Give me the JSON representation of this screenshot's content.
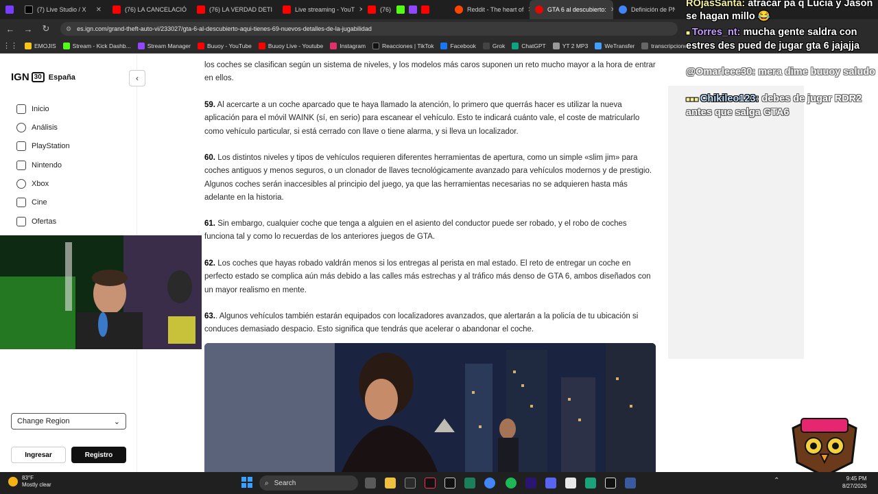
{
  "browser": {
    "tabs": [
      {
        "label": "",
        "color": "#7a3cff",
        "active": false
      },
      {
        "label": "(7) Live Studio / X",
        "color": "#000000",
        "active": false
      },
      {
        "label": "(76) LA CANCELACIÓ",
        "color": "#ff0000",
        "active": false
      },
      {
        "label": "(76) LA VERDAD DETI",
        "color": "#ff0000",
        "active": false
      },
      {
        "label": "Live streaming - YouT",
        "color": "#ff0000",
        "active": false
      },
      {
        "label": "(76)",
        "color": "#ff0000",
        "active": false
      },
      {
        "label": "Reddit - The heart of",
        "color": "#ff4500",
        "active": false
      },
      {
        "label": "GTA 6 al descubierto:",
        "color": "#e10a00",
        "active": true
      },
      {
        "label": "Definición de PN| en",
        "color": "#4285f4",
        "active": false
      }
    ],
    "url": "es.ign.com/grand-theft-auto-vi/233027/gta-6-al-descubierto-aqui-tienes-69-nuevos-detalles-de-la-jugabilidad",
    "bookmarks": [
      {
        "label": "EMOJIS",
        "color": "#f5c518"
      },
      {
        "label": "Stream - Kick Dashb...",
        "color": "#53fc18"
      },
      {
        "label": "Stream Manager",
        "color": "#9146ff"
      },
      {
        "label": "Buuoy - YouTube",
        "color": "#ff0000"
      },
      {
        "label": "Buuoy Live - Youtube",
        "color": "#ff0000"
      },
      {
        "label": "Instagram",
        "color": "#e1306c"
      },
      {
        "label": "Reacciones | TikTok",
        "color": "#111111"
      },
      {
        "label": "Facebook",
        "color": "#1877f2"
      },
      {
        "label": "Grok",
        "color": "#444444"
      },
      {
        "label": "ChatGPT",
        "color": "#10a37f"
      },
      {
        "label": "YT 2 MP3",
        "color": "#999999"
      },
      {
        "label": "WeTransfer",
        "color": "#409fff"
      },
      {
        "label": "transcripciones",
        "color": "#666666"
      }
    ]
  },
  "site": {
    "logo_brand": "IGN",
    "logo_badge": "30",
    "logo_region": "España",
    "nav": [
      {
        "label": "Inicio",
        "icon": "home-icon"
      },
      {
        "label": "Análisis",
        "icon": "review-icon"
      },
      {
        "label": "PlayStation",
        "icon": "playstation-icon"
      },
      {
        "label": "Nintendo",
        "icon": "nintendo-icon"
      },
      {
        "label": "Xbox",
        "icon": "xbox-icon"
      },
      {
        "label": "Cine",
        "icon": "film-icon"
      },
      {
        "label": "Ofertas",
        "icon": "tag-icon"
      }
    ],
    "region_select": "Change Region",
    "login_label": "Ingresar",
    "register_label": "Registro"
  },
  "article": {
    "paragraphs": [
      {
        "num": "",
        "text": "los coches se clasifican según un sistema de niveles, y los modelos más caros suponen un reto mucho mayor a la hora de entrar en ellos."
      },
      {
        "num": "59.",
        "text": " Al acercarte a un coche aparcado que te haya llamado la atención, lo primero que querrás hacer es utilizar la nueva aplicación para el móvil WAINK (sí, en serio) para escanear el vehículo. Esto te indicará cuánto vale, el coste de matricularlo como vehículo particular, si está cerrado con llave o tiene alarma, y si lleva un localizador."
      },
      {
        "num": "60.",
        "text": " Los distintos niveles y tipos de vehículos requieren diferentes herramientas de apertura, como un simple «slim jim» para coches antiguos y menos seguros, o un clonador de llaves tecnológicamente avanzado para vehículos modernos y de prestigio. Algunos coches serán inaccesibles al principio del juego, ya que las herramientas necesarias no se adquieren hasta más adelante en la historia."
      },
      {
        "num": "61.",
        "text": " Sin embargo, cualquier coche que tenga a alguien en el asiento del conductor puede ser robado, y el robo de coches funciona tal y como lo recuerdas de los anteriores juegos de GTA."
      },
      {
        "num": "62.",
        "text": " Los coches que hayas robado valdrán menos si los entregas al perista en mal estado. El reto de entregar un coche en perfecto estado se complica aún más debido a las calles más estrechas y al tráfico más denso de GTA 6, ambos diseñados con un mayor realismo en mente."
      },
      {
        "num": "63.",
        "text": ". Algunos vehículos también estarán equipados con localizadores avanzados, que alertarán a la policía de tu ubicación si conduces demasiado despacio. Esto significa que tendrás que acelerar o abandonar el coche."
      }
    ]
  },
  "chat": [
    {
      "user": "ROjasSanta:",
      "text": " atracar pa q Lucia y Jason se hagan millo 😂"
    },
    {
      "user": "Torres_nt:",
      "text": " mucha gente saldra con estres des pued de jugar gta 6 jajajja"
    },
    {
      "user": "",
      "text": "@Omarleee30: mera dime buuoy saludo"
    },
    {
      "user": "Chikileo123:",
      "text": " debes de jugar RDR2 antes que salga GTA6"
    }
  ],
  "taskbar": {
    "weather_temp": "83°F",
    "weather_desc": "Mostly clear",
    "search_label": "Search",
    "time": "9:45 PM",
    "date": "8/27/2026"
  }
}
